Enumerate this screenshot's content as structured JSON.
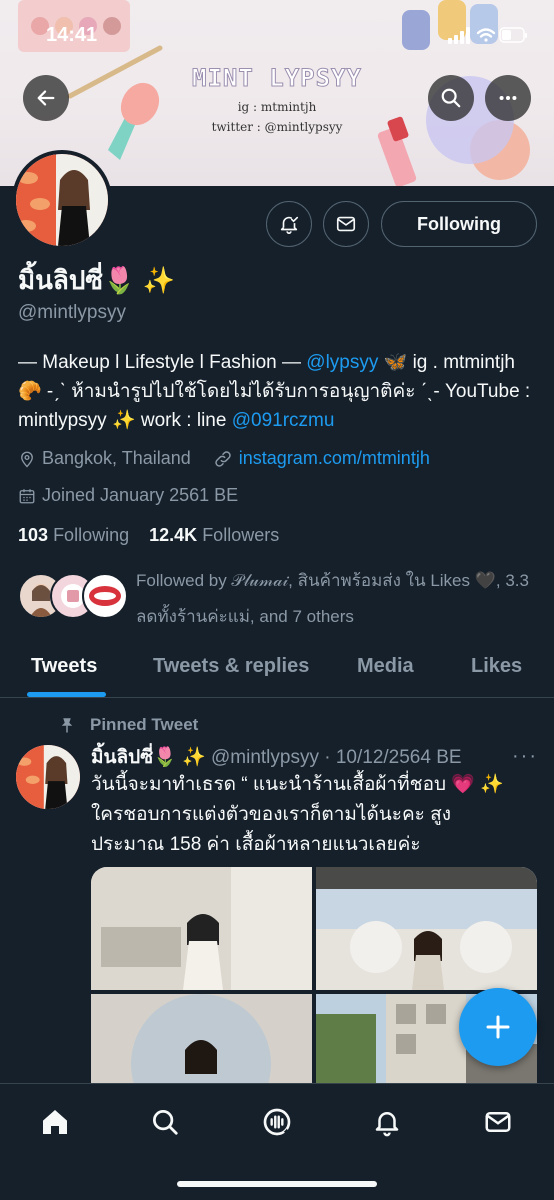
{
  "status_bar": {
    "time": "14:41"
  },
  "banner": {
    "title": "MINT LYPSYY",
    "line1": "ig : mtmintjh",
    "line2": "twitter : @mintlypsyy"
  },
  "header_icons": {
    "back": "arrow-left-icon",
    "search": "search-icon",
    "more": "more-horizontal-icon"
  },
  "profile": {
    "display_name": "มิ้นลิปซี่🌷 ✨",
    "handle": "@mintlypsyy",
    "following_button": "Following",
    "bio": {
      "part1": "— Makeup l Lifestyle l Fashion — ",
      "mention1": "@lypsyy",
      "part2": " 🦋 ig . mtmintjh 🥐 -ˏˋ ห้ามนำรูปไปใช้โดยไม่ได้รับการอนุญาติค่ะ ˊˎ- YouTube : mintlypsyy ✨ work : line ",
      "mention2": "@091rczmu"
    },
    "location": "Bangkok, Thailand",
    "website": "instagram.com/mtmintjh",
    "joined": "Joined January 2561 BE",
    "following_count": "103",
    "following_label": "Following",
    "followers_count": "12.4K",
    "followers_label": "Followers",
    "followed_by": "Followed by 𝒫𝓁𝓊𝓂𝒶𝒾, สินค้าพร้อมส่ง ใน Likes 🖤, 3.3 ลดทั้งร้านค่ะแม่, and 7 others"
  },
  "tabs": [
    {
      "label": "Tweets"
    },
    {
      "label": "Tweets & replies"
    },
    {
      "label": "Media"
    },
    {
      "label": "Likes"
    }
  ],
  "tweet": {
    "pinned_label": "Pinned Tweet",
    "name": "มิ้นลิปซี่🌷 ✨",
    "handle_date": " @mintlypsyy · 10/12/2564 BE",
    "more": "···",
    "text": "วันนี้จะมาทำเธรด “ แนะนำร้านเสื้อผ้าที่ชอบ 💗 ✨ ใครชอบการแต่งตัวของเราก็ตามได้นะคะ สูงประมาณ 158 ค่า เสื้อผ้าหลายแนวเลยค่ะ"
  },
  "fab": {
    "icon": "compose-plus-icon"
  },
  "bottom_nav": [
    {
      "name": "home",
      "icon": "home-icon"
    },
    {
      "name": "search",
      "icon": "search-icon"
    },
    {
      "name": "spaces",
      "icon": "spaces-icon"
    },
    {
      "name": "notifications",
      "icon": "bell-icon"
    },
    {
      "name": "messages",
      "icon": "mail-icon"
    }
  ],
  "colors": {
    "background": "#15202b",
    "accent": "#1d9bf0",
    "muted": "#8b98a5",
    "border": "#38444d"
  }
}
